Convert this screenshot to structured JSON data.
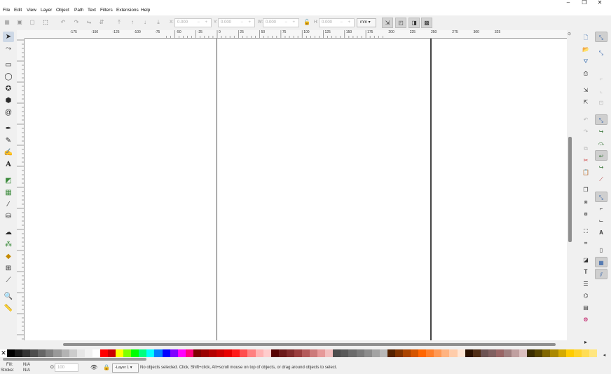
{
  "window": {
    "minimize": "–",
    "maximize": "❐",
    "close": "✕"
  },
  "menubar": [
    "File",
    "Edit",
    "View",
    "Layer",
    "Object",
    "Path",
    "Text",
    "Filters",
    "Extensions",
    "Help"
  ],
  "toolbar": {
    "x_label": "X:",
    "x_value": "0.000",
    "y_label": "Y:",
    "y_value": "0.000",
    "w_label": "W:",
    "w_value": "0.000",
    "h_label": "H:",
    "h_value": "0.000",
    "spin_controls": "− +",
    "units": "mm"
  },
  "ruler_labels": [
    "-175",
    "-150",
    "-125",
    "-100",
    "-75",
    "-50",
    "-25",
    "0",
    "25",
    "50",
    "75",
    "100",
    "125",
    "150",
    "175",
    "200",
    "225",
    "250",
    "275",
    "300",
    "325"
  ],
  "tools": [
    "selector-tool",
    "node-tool",
    "rect-tool",
    "ellipse-tool",
    "star-tool",
    "3dbox-tool",
    "spiral-tool",
    "pen-tool",
    "pencil-tool",
    "calligraphy-tool",
    "text-tool",
    "gradient-tool",
    "mesh-tool",
    "dropper-tool",
    "paint-bucket-tool",
    "tweak-tool",
    "spray-tool",
    "eraser-tool",
    "connector-tool",
    "lpe-tool",
    "zoom-tool",
    "measure-tool"
  ],
  "palette": [
    "#000000",
    "#1a1a1a",
    "#333333",
    "#4d4d4d",
    "#666666",
    "#808080",
    "#999999",
    "#b3b3b3",
    "#cccccc",
    "#e6e6e6",
    "#f2f2f2",
    "#ffffff",
    "#ff0000",
    "#cc0000",
    "#ffff00",
    "#80ff00",
    "#00ff00",
    "#00ff80",
    "#00ffff",
    "#0080ff",
    "#0000ff",
    "#8000ff",
    "#ff00ff",
    "#ff0080",
    "#800000",
    "#990000",
    "#b30000",
    "#cc0000",
    "#e60000",
    "#ff1a1a",
    "#ff4d4d",
    "#ff8080",
    "#ffb3b3",
    "#ffcccc",
    "#550000",
    "#6b1a1a",
    "#802b2b",
    "#993d3d",
    "#b35959",
    "#cc7a7a",
    "#e69999",
    "#f2bfbf",
    "#4d4d4d",
    "#595959",
    "#6b6b6b",
    "#7a7a7a",
    "#8c8c8c",
    "#a3a3a3",
    "#b8b8b8",
    "#552200",
    "#803300",
    "#aa4400",
    "#d45500",
    "#ff6600",
    "#ff7f2a",
    "#ff9955",
    "#ffb380",
    "#ffccaa",
    "#ffe6d5",
    "#2b1100",
    "#502d16",
    "#6c5353",
    "#806060",
    "#996666",
    "#a08080",
    "#c0a0a0",
    "#dbc0c0",
    "#3a2d00",
    "#554400",
    "#806600",
    "#aa8800",
    "#d4aa00",
    "#ffcc00",
    "#ffd42a",
    "#ffdd55",
    "#ffe680"
  ],
  "status": {
    "fill_label": "Fill:",
    "fill_value": "N/A",
    "stroke_label": "Stroke:",
    "stroke_value": "N/A",
    "opacity_label": "O:",
    "opacity_value": "100",
    "layer": "-Layer 1",
    "message": "No objects selected. Click, Shift+click, Alt+scroll mouse on top of objects, or drag around objects to select."
  }
}
